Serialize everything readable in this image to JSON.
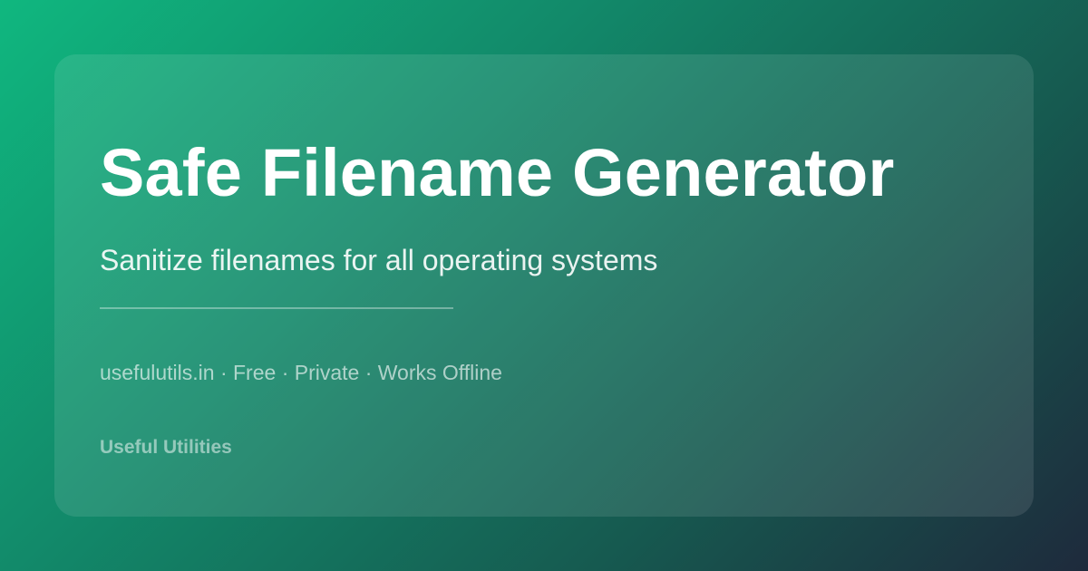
{
  "card": {
    "title": "Safe Filename Generator",
    "subtitle": "Sanitize filenames for all operating systems",
    "meta_line": "usefulutils.in · Free · Private · Works Offline",
    "brand": "Useful Utilities"
  },
  "colors": {
    "gradient_start": "#10b77f",
    "gradient_end": "#1e2a3c",
    "text": "#ffffff"
  }
}
